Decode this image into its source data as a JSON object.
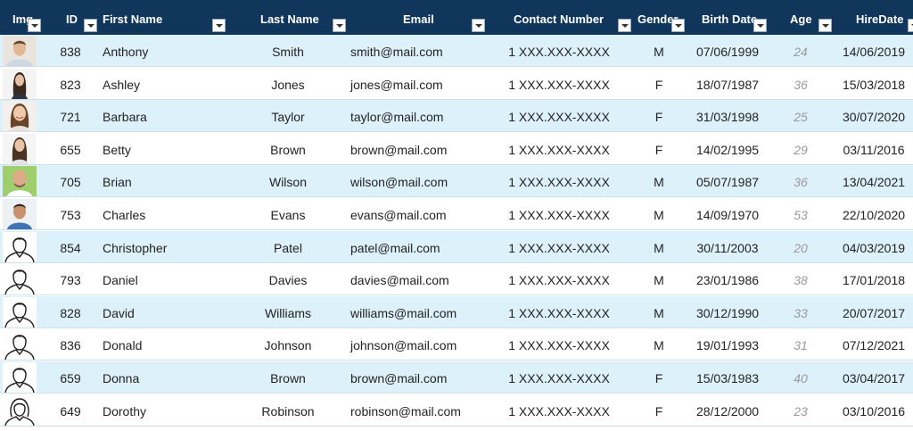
{
  "columns": {
    "img": "Img",
    "id": "ID",
    "first_name": "First Name",
    "last_name": "Last Name",
    "email": "Email",
    "contact": "Contact Number",
    "gender": "Gender",
    "birth_date": "Birth Date",
    "age": "Age",
    "hire_date": "HireDate"
  },
  "colors": {
    "header_bg": "#10365c",
    "band_row": "#ddf1fa",
    "age_text": "#9a9a9a"
  },
  "rows": [
    {
      "photo": "photo-man-light-shirt",
      "id": "838",
      "first_name": "Anthony",
      "last_name": "Smith",
      "email": "smith@mail.com",
      "contact": "1 XXX.XXX-XXXX",
      "gender": "M",
      "birth_date": "07/06/1999",
      "age": "24",
      "hire_date": "14/06/2019"
    },
    {
      "photo": "photo-woman-long-hair",
      "id": "823",
      "first_name": "Ashley",
      "last_name": "Jones",
      "email": "jones@mail.com",
      "contact": "1 XXX.XXX-XXXX",
      "gender": "F",
      "birth_date": "18/07/1987",
      "age": "36",
      "hire_date": "15/03/2018"
    },
    {
      "photo": "photo-woman-smiling",
      "id": "721",
      "first_name": "Barbara",
      "last_name": "Taylor",
      "email": "taylor@mail.com",
      "contact": "1 XXX.XXX-XXXX",
      "gender": "F",
      "birth_date": "31/03/1998",
      "age": "25",
      "hire_date": "30/07/2020"
    },
    {
      "photo": "photo-woman-dark-hair",
      "id": "655",
      "first_name": "Betty",
      "last_name": "Brown",
      "email": "brown@mail.com",
      "contact": "1 XXX.XXX-XXXX",
      "gender": "F",
      "birth_date": "14/02/1995",
      "age": "29",
      "hire_date": "03/11/2016"
    },
    {
      "photo": "photo-man-bald-green-bg",
      "id": "705",
      "first_name": "Brian",
      "last_name": "Wilson",
      "email": "wilson@mail.com",
      "contact": "1 XXX.XXX-XXXX",
      "gender": "M",
      "birth_date": "05/07/1987",
      "age": "36",
      "hire_date": "13/04/2021"
    },
    {
      "photo": "photo-man-blue-shirt",
      "id": "753",
      "first_name": "Charles",
      "last_name": "Evans",
      "email": "evans@mail.com",
      "contact": "1 XXX.XXX-XXXX",
      "gender": "M",
      "birth_date": "14/09/1970",
      "age": "53",
      "hire_date": "22/10/2020"
    },
    {
      "photo": "male-avatar-outline",
      "id": "854",
      "first_name": "Christopher",
      "last_name": "Patel",
      "email": "patel@mail.com",
      "contact": "1 XXX.XXX-XXXX",
      "gender": "M",
      "birth_date": "30/11/2003",
      "age": "20",
      "hire_date": "04/03/2019"
    },
    {
      "photo": "male-avatar-outline",
      "id": "793",
      "first_name": "Daniel",
      "last_name": "Davies",
      "email": "davies@mail.com",
      "contact": "1 XXX.XXX-XXXX",
      "gender": "M",
      "birth_date": "23/01/1986",
      "age": "38",
      "hire_date": "17/01/2018"
    },
    {
      "photo": "male-avatar-outline",
      "id": "828",
      "first_name": "David",
      "last_name": "Williams",
      "email": "williams@mail.com",
      "contact": "1 XXX.XXX-XXXX",
      "gender": "M",
      "birth_date": "30/12/1990",
      "age": "33",
      "hire_date": "20/07/2017"
    },
    {
      "photo": "male-avatar-outline",
      "id": "836",
      "first_name": "Donald",
      "last_name": "Johnson",
      "email": "johnson@mail.com",
      "contact": "1 XXX.XXX-XXXX",
      "gender": "M",
      "birth_date": "19/01/1993",
      "age": "31",
      "hire_date": "07/12/2021"
    },
    {
      "photo": "male-avatar-outline",
      "id": "659",
      "first_name": "Donna",
      "last_name": "Brown",
      "email": "brown@mail.com",
      "contact": "1 XXX.XXX-XXXX",
      "gender": "F",
      "birth_date": "15/03/1983",
      "age": "40",
      "hire_date": "03/04/2017"
    },
    {
      "photo": "female-avatar-outline",
      "id": "649",
      "first_name": "Dorothy",
      "last_name": "Robinson",
      "email": "robinson@mail.com",
      "contact": "1 XXX.XXX-XXXX",
      "gender": "F",
      "birth_date": "28/12/2000",
      "age": "23",
      "hire_date": "03/10/2016"
    }
  ]
}
